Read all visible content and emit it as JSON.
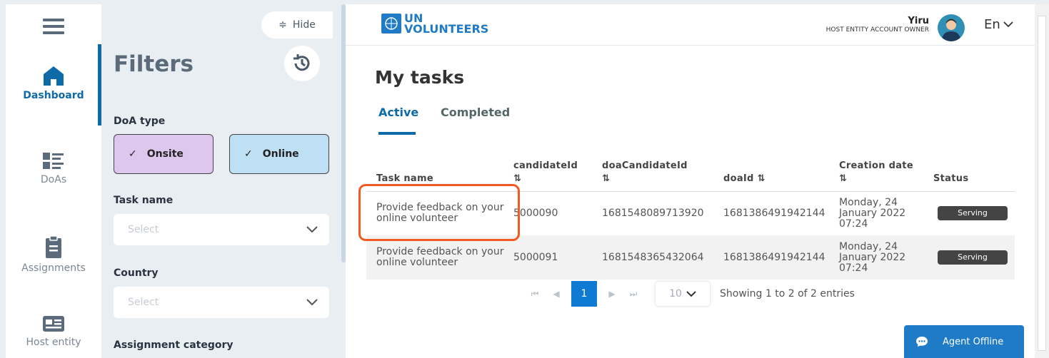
{
  "nav": {
    "items": [
      {
        "label": "Dashboard",
        "icon": "home-icon",
        "active": true
      },
      {
        "label": "DoAs",
        "icon": "list-icon"
      },
      {
        "label": "Assignments",
        "icon": "clipboard-icon"
      },
      {
        "label": "Host entity",
        "icon": "id-card-icon"
      }
    ]
  },
  "filters": {
    "hide_label": "Hide",
    "title": "Filters",
    "doa_type_label": "DoA type",
    "chips": [
      "Onsite",
      "Online"
    ],
    "task_name_label": "Task name",
    "task_name_placeholder": "Select",
    "country_label": "Country",
    "country_placeholder": "Select",
    "assignment_category_label": "Assignment category"
  },
  "header": {
    "logo_line1": "UN",
    "logo_line2": "VOLUNTEERS",
    "user_name": "Yiru",
    "user_role": "HOST ENTITY ACCOUNT OWNER",
    "language": "En"
  },
  "main": {
    "title": "My tasks",
    "tabs": [
      "Active",
      "Completed"
    ]
  },
  "table": {
    "columns": [
      "Task name",
      "candidateId",
      "doaCandidateId",
      "doaId",
      "Creation date",
      "Status"
    ],
    "sort_glyph": "⇅",
    "rows": [
      {
        "task": "Provide feedback on your online volunteer",
        "candidateId": "5000090",
        "doaCandidateId": "1681548089713920",
        "doaId": "1681386491942144",
        "date": "Monday, 24 January 2022 07:24",
        "status": "Serving"
      },
      {
        "task": "Provide feedback on your online volunteer",
        "candidateId": "5000091",
        "doaCandidateId": "1681548365432064",
        "doaId": "1681386491942144",
        "date": "Monday, 24 January 2022 07:24",
        "status": "Serving"
      }
    ]
  },
  "pagination": {
    "current_page": "1",
    "page_size": "10",
    "info": "Showing 1 to 2 of 2 entries"
  },
  "chat": {
    "label": "Agent Offline"
  },
  "colors": {
    "accent": "#0f6aa8",
    "onsite_chip": "#ddc7ef",
    "online_chip": "#bfdff4",
    "highlight": "#f15a22"
  }
}
